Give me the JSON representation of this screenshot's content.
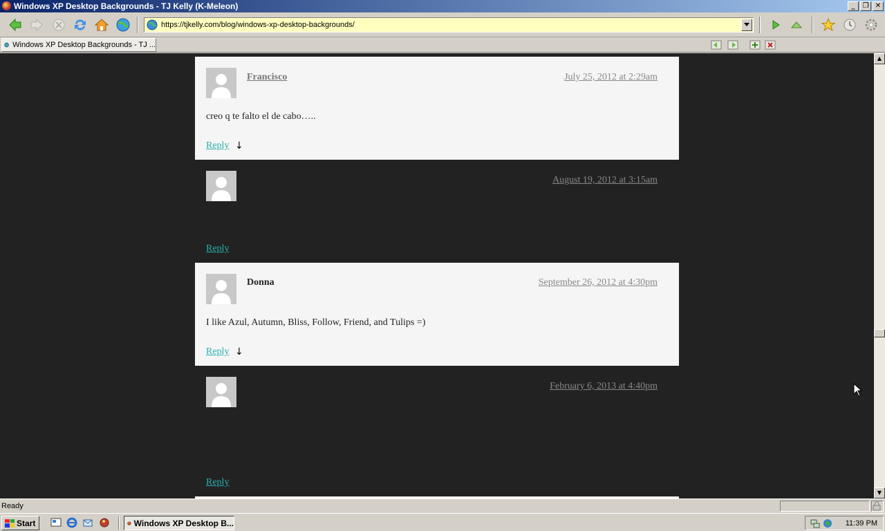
{
  "window": {
    "title": "Windows XP Desktop Backgrounds - TJ Kelly (K-Meleon)"
  },
  "window_controls": {
    "minimize": "_",
    "maximize": "❐",
    "close": "✕"
  },
  "address": {
    "url": "https://tjkelly.com/blog/windows-xp-desktop-backgrounds/"
  },
  "tab": {
    "label": "Windows XP Desktop Backgrounds - TJ ..."
  },
  "comments": [
    {
      "author": "Francisco",
      "date": "July 25, 2012 at 2:29am",
      "text": "creo q te falto el de cabo…..",
      "reply": "Reply",
      "arrow": "↓"
    },
    {
      "author": "",
      "date": "August 19, 2012 at 3:15am",
      "text": "",
      "reply": "Reply"
    },
    {
      "author": "Donna",
      "date": "September 26, 2012 at 4:30pm",
      "text": "I like Azul, Autumn, Bliss, Follow, Friend, and Tulips =)",
      "reply": "Reply",
      "arrow": "↓"
    },
    {
      "author": "",
      "date": "February 6, 2013 at 4:40pm",
      "text": "",
      "reply": "Reply"
    }
  ],
  "scrollbar": {
    "up": "▲",
    "down": "▼"
  },
  "status": {
    "text": "Ready"
  },
  "taskbar": {
    "start_label": "Start",
    "task_label": "Windows XP Desktop B...",
    "clock": "11:39 PM"
  },
  "colors": {
    "page_bg": "#222222",
    "comment_bg": "#f5f5f5",
    "reply_link": "#2ab0b0",
    "url_bg": "#ffffc0"
  }
}
